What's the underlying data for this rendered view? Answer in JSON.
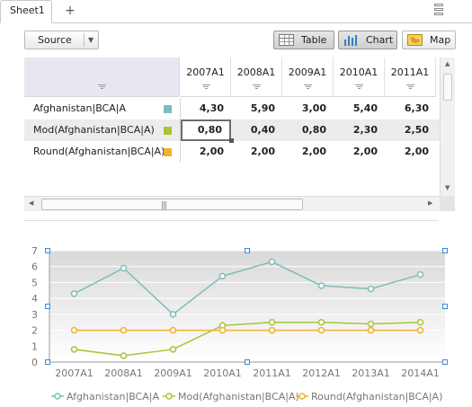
{
  "tabs": {
    "active": "Sheet1",
    "add": "+"
  },
  "toolbar": {
    "source": "Source",
    "table": "Table",
    "chart": "Chart",
    "map": "Map"
  },
  "grid": {
    "columns": [
      "2007A1",
      "2008A1",
      "2009A1",
      "2010A1",
      "2011A1"
    ],
    "rows": [
      {
        "label": "Afghanistan|BCA|A",
        "color": "#7fbcb9",
        "values": [
          "4,30",
          "5,90",
          "3,00",
          "5,40",
          "6,30"
        ]
      },
      {
        "label": "Mod(Afghanistan|BCA|A)",
        "color": "#a8c43a",
        "values": [
          "0,80",
          "0,40",
          "0,80",
          "2,30",
          "2,50"
        ]
      },
      {
        "label": "Round(Afghanistan|BCA|A)",
        "color": "#f0b030",
        "values": [
          "2,00",
          "2,00",
          "2,00",
          "2,00",
          "2,00"
        ]
      }
    ],
    "selected_cell": {
      "row": 1,
      "col": 0
    }
  },
  "chart_data": {
    "type": "line",
    "categories": [
      "2007A1",
      "2008A1",
      "2009A1",
      "2010A1",
      "2011A1",
      "2012A1",
      "2013A1",
      "2014A1"
    ],
    "ylim": [
      0,
      7
    ],
    "yticks": [
      "0",
      "1",
      "2",
      "3",
      "4",
      "5",
      "6",
      "7"
    ],
    "grid": true,
    "legend_position": "bottom",
    "series": [
      {
        "name": "Afghanistan|BCA|A",
        "color": "#7fbcb9",
        "values": [
          4.3,
          5.9,
          3.0,
          5.4,
          6.3,
          4.8,
          4.6,
          5.5
        ]
      },
      {
        "name": "Mod(Afghanistan|BCA|A)",
        "color": "#a8c43a",
        "values": [
          0.8,
          0.4,
          0.8,
          2.3,
          2.5,
          2.5,
          2.4,
          2.5
        ]
      },
      {
        "name": "Round(Afghanistan|BCA|A)",
        "color": "#f0b030",
        "values": [
          2.0,
          2.0,
          2.0,
          2.0,
          2.0,
          2.0,
          2.0,
          2.0
        ]
      }
    ]
  }
}
